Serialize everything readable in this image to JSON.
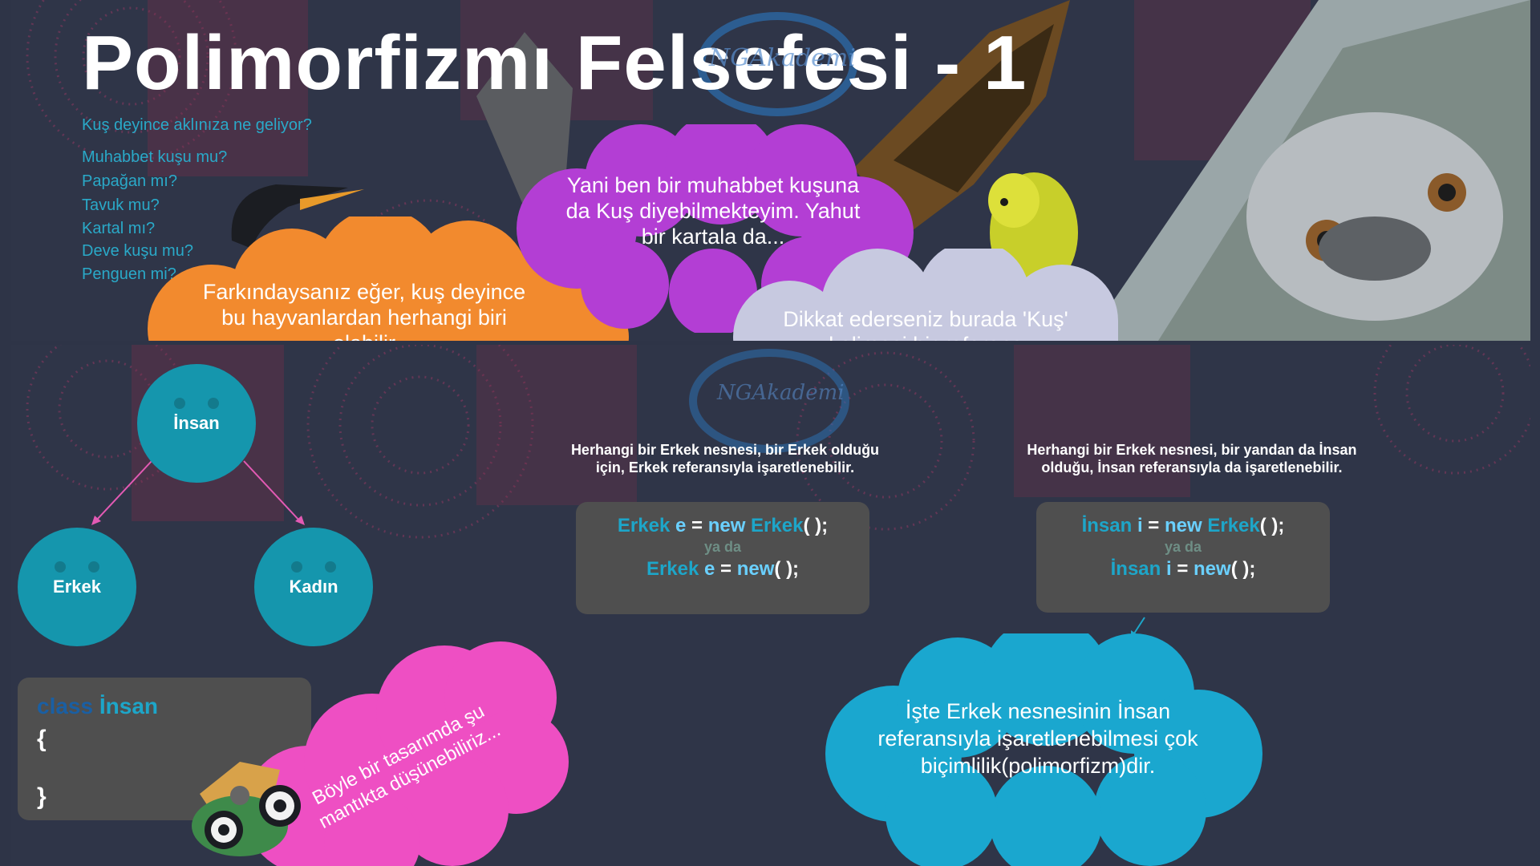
{
  "slide_top": {
    "title": "Polimorfizmı Felsefesi - 1",
    "question_heading": "Kuş deyince aklınıza ne geliyor?",
    "bird_questions": [
      "Muhabbet kuşu mu?",
      "Papağan mı?",
      "Tavuk mu?",
      "Kartal mı?",
      "Deve kuşu mu?",
      "Penguen mi?"
    ],
    "orange_cloud": "Farkındaysanız eğer, kuş deyince bu hayvanlardan herhangi biri olabilir",
    "purple_cloud": "Yani ben bir muhabbet kuşuna da Kuş diyebilmekteyim. Yahut bir kartala da...",
    "gray_cloud": "Dikkat ederseniz burada 'Kuş' kelimesi bir referans",
    "watermark": "NGAkademi"
  },
  "slide_bottom": {
    "nodes": {
      "root": "İnsan",
      "left": "Erkek",
      "right": "Kadın"
    },
    "class_box": {
      "keyword": "class",
      "name": "İnsan",
      "open": "{",
      "close": "}"
    },
    "pink_cloud": "Böyle bir tasarımda şu mantıkta düşünebiliriz...",
    "caption_1": "Herhangi bir Erkek nesnesi, bir Erkek olduğu için, Erkek referansıyla işaretlenebilir.",
    "caption_2": "Herhangi bir Erkek nesnesi, bir yandan da İnsan olduğu, İnsan referansıyla da işaretlenebilir.",
    "code_1": {
      "type": "Erkek",
      "var": "e",
      "eq": "=",
      "new": "new",
      "ctor": "Erkek",
      "tail": "( );",
      "or": "ya da",
      "tail2": "( );"
    },
    "code_2": {
      "type": "İnsan",
      "var": "i",
      "eq": "=",
      "new": "new",
      "ctor": "Erkek",
      "tail": "( );",
      "or": "ya da",
      "tail2": "( );"
    },
    "blue_cloud": "İşte Erkek nesnesinin İnsan referansıyla işaretlenebilmesi çok biçimlilik(polimorfizm)dir."
  },
  "colors": {
    "background": "#2e3447",
    "accent_blue": "#1596ad",
    "orange": "#f28a2e",
    "purple": "#b33ed4",
    "pink": "#ee4fc3",
    "cloud_blue": "#1aa7cf"
  }
}
